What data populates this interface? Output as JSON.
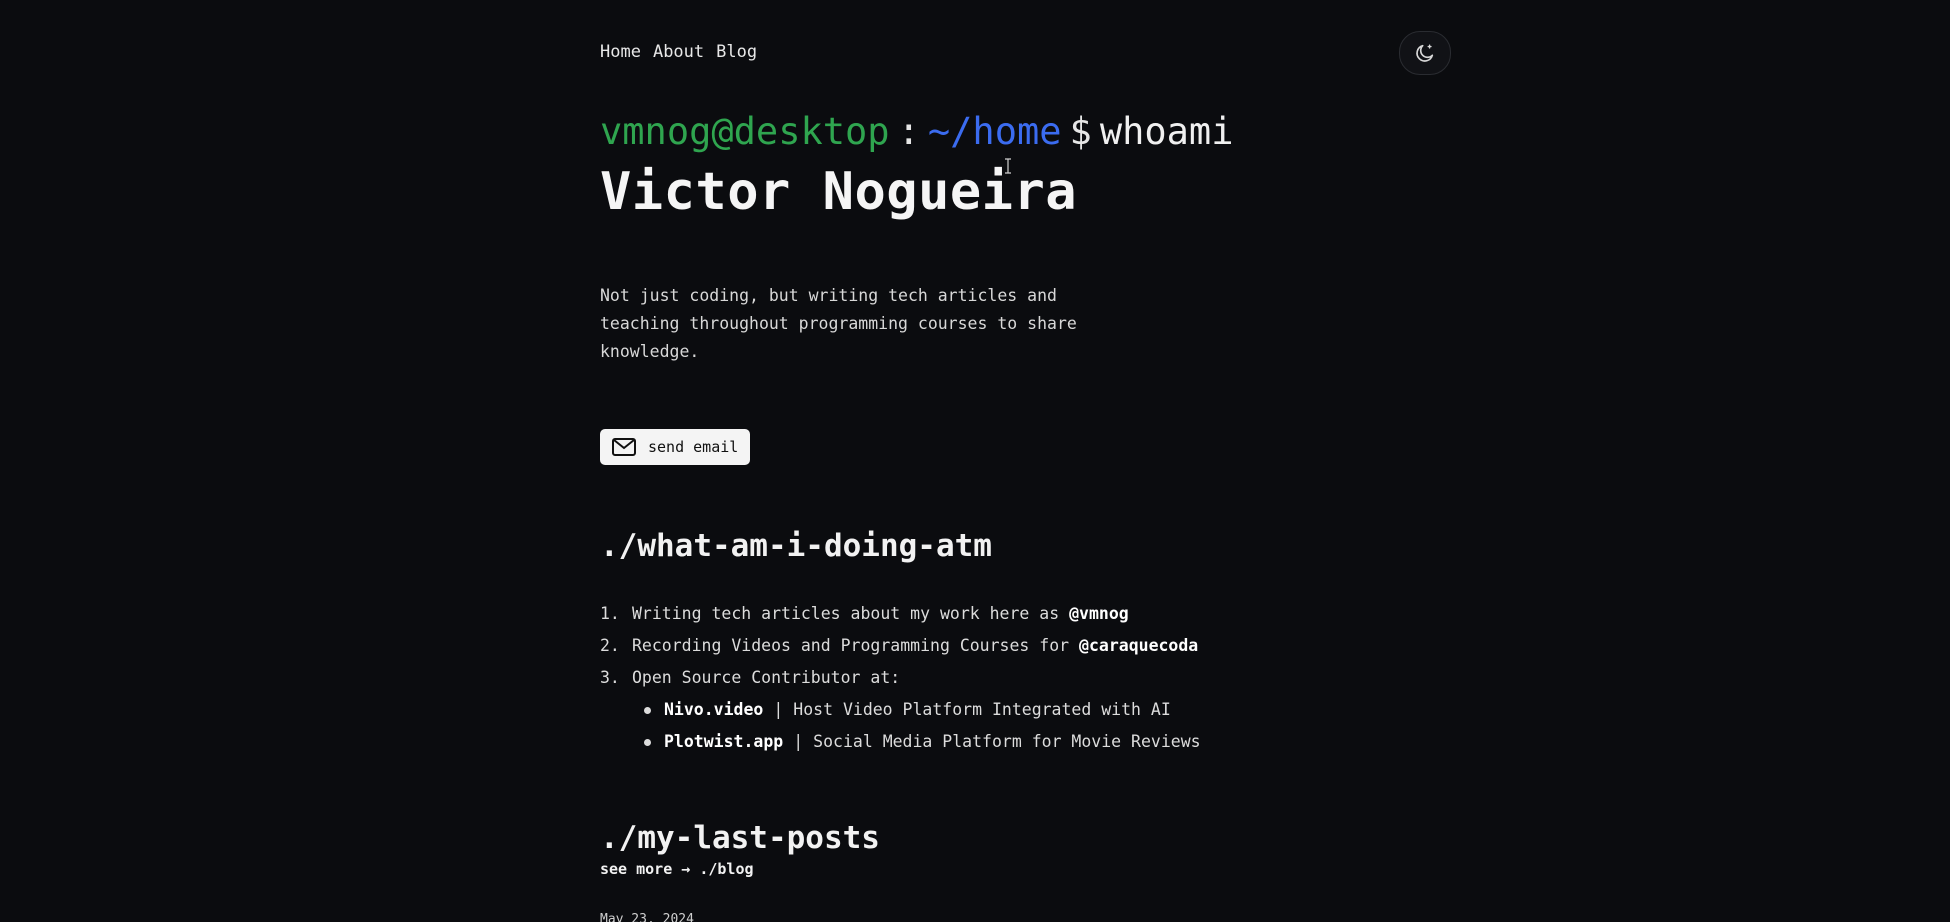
{
  "nav": {
    "items": [
      "Home",
      "About",
      "Blog"
    ]
  },
  "theme_toggle": {
    "icon": "moon-icon"
  },
  "prompt": {
    "user": "vmnog@desktop",
    "colon": ":",
    "path": "~/home",
    "dollar": "$",
    "command": "whoami"
  },
  "title": "Victor Nogueira",
  "bio": "Not just coding, but writing tech articles and teaching throughout programming courses to share knowledge.",
  "email_button": {
    "label": "send email",
    "icon": "mail-icon"
  },
  "doing": {
    "title": "./what-am-i-doing-atm",
    "items": [
      {
        "num": "1.",
        "text": "Writing tech articles about my work here as ",
        "handle": "@vmnog"
      },
      {
        "num": "2.",
        "text": "Recording Videos and Programming Courses for ",
        "handle": "@caraquecoda"
      },
      {
        "num": "3.",
        "text": "Open Source Contributor at:",
        "handle": ""
      }
    ],
    "projects": [
      {
        "name": "Nivo.video",
        "separator": "|",
        "description": "Host Video Platform Integrated with AI"
      },
      {
        "name": "Plotwist.app",
        "separator": "|",
        "description": "Social Media Platform for Movie Reviews"
      }
    ]
  },
  "posts": {
    "title": "./my-last-posts",
    "see_more": "see more → ./blog",
    "first_date": "May 23, 2024"
  },
  "colors": {
    "background": "#0b0c0f",
    "user": "#2fa54f",
    "path": "#3b6cf0"
  }
}
